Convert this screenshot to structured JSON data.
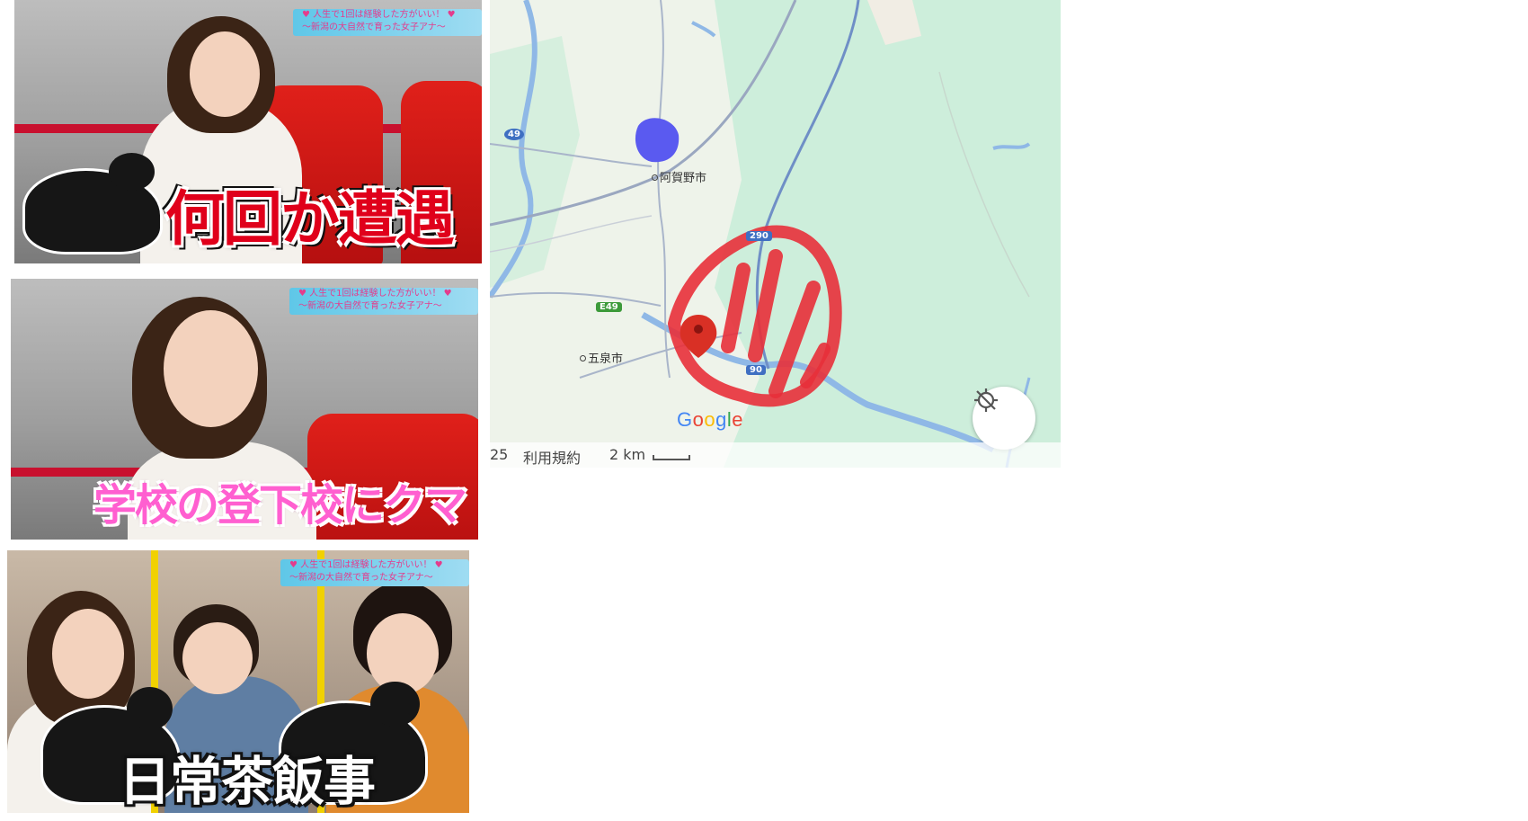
{
  "stills": [
    {
      "caption": "何回か遭遇",
      "banner_line1": "♥ 人生で1回は経験した方がいい！ ♥",
      "banner_line2": "～新潟の大自然で育った女子アナ～"
    },
    {
      "caption": "学校の登下校にクマ",
      "banner_line1": "♥ 人生で1回は経験した方がいい！ ♥",
      "banner_line2": "～新潟の大自然で育った女子アナ～"
    },
    {
      "caption": "日常茶飯事",
      "banner_line1": "♥ 人生で1回は経験した方がいい！ ♥",
      "banner_line2": "～新潟の大自然で育った女子アナ～"
    }
  ],
  "map": {
    "places": {
      "agano": "阿賀野市",
      "gosen": "五泉市"
    },
    "shields": {
      "route49": "49",
      "route290": "290",
      "e49": "E49",
      "ex": "90"
    },
    "google_logo": [
      "G",
      "o",
      "o",
      "g",
      "l",
      "e"
    ],
    "footer": {
      "year": "25",
      "terms": "利用規約",
      "scale": "2 km"
    },
    "colors": {
      "annotation_red": "#e8303a",
      "blue_mark": "#5a5af0",
      "pin": "#d93025",
      "water": "#8fb8e6",
      "forest": "#cdeedb"
    }
  }
}
